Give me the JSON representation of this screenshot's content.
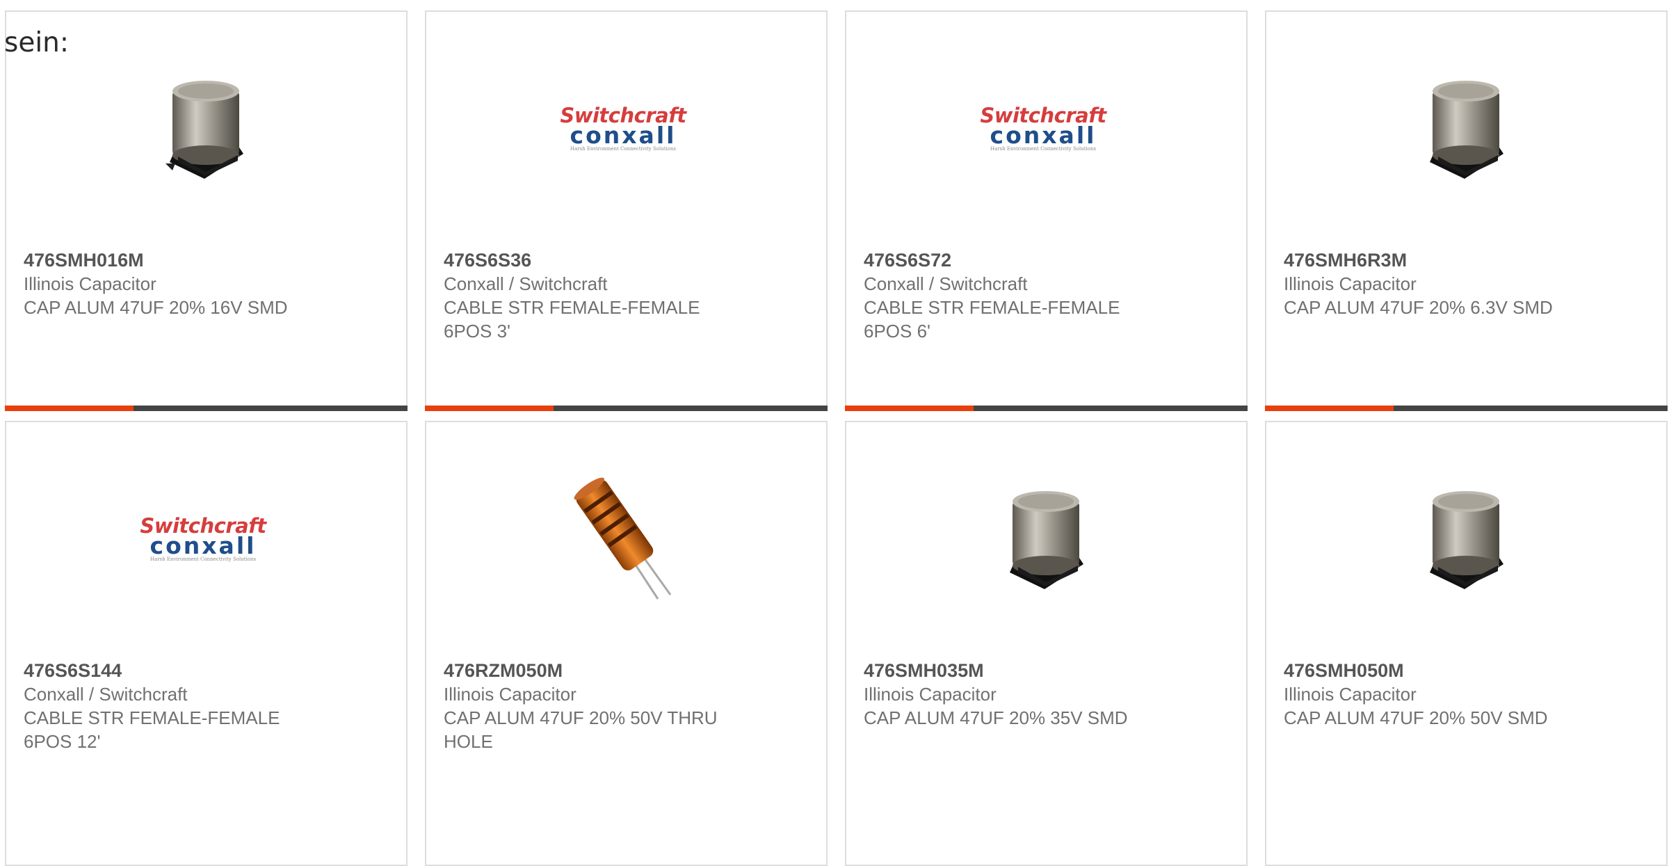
{
  "page": {
    "intro_text": "sein:"
  },
  "logo": {
    "line1": "Switchcraft",
    "line2": "conxall",
    "tagline": "Harsh Environment Connectivity Solutions"
  },
  "products": [
    {
      "part_number": "476SMH016M",
      "manufacturer": "Illinois Capacitor",
      "description": "CAP ALUM 47UF 20% 16V SMD",
      "image_icon": "smd-capacitor-icon",
      "progress_percent": 32
    },
    {
      "part_number": "476S6S36",
      "manufacturer": "Conxall / Switchcraft",
      "description_lines": [
        "CABLE STR FEMALE-FEMALE",
        "6POS 3'"
      ],
      "image_icon": "switchcraft-conxall-logo",
      "progress_percent": 32
    },
    {
      "part_number": "476S6S72",
      "manufacturer": "Conxall / Switchcraft",
      "description_lines": [
        "CABLE STR FEMALE-FEMALE",
        "6POS 6'"
      ],
      "image_icon": "switchcraft-conxall-logo",
      "progress_percent": 32
    },
    {
      "part_number": "476SMH6R3M",
      "manufacturer": "Illinois Capacitor",
      "description": "CAP ALUM 47UF 20% 6.3V SMD",
      "image_icon": "smd-capacitor-icon",
      "progress_percent": 32
    },
    {
      "part_number": "476S6S144",
      "manufacturer": "Conxall / Switchcraft",
      "description_lines": [
        "CABLE STR FEMALE-FEMALE",
        "6POS 12'"
      ],
      "image_icon": "switchcraft-conxall-logo"
    },
    {
      "part_number": "476RZM050M",
      "manufacturer": "Illinois Capacitor",
      "description_lines": [
        "CAP ALUM 47UF 20% 50V THRU",
        "HOLE"
      ],
      "image_icon": "radial-capacitor-icon"
    },
    {
      "part_number": "476SMH035M",
      "manufacturer": "Illinois Capacitor",
      "description": "CAP ALUM 47UF 20% 35V SMD",
      "image_icon": "smd-capacitor-icon"
    },
    {
      "part_number": "476SMH050M",
      "manufacturer": "Illinois Capacitor",
      "description": "CAP ALUM 47UF 20% 50V SMD",
      "image_icon": "smd-capacitor-icon"
    }
  ],
  "colors": {
    "accent": "#e8400c",
    "track": "#444444",
    "border": "#dddddd",
    "text": "#707070"
  }
}
